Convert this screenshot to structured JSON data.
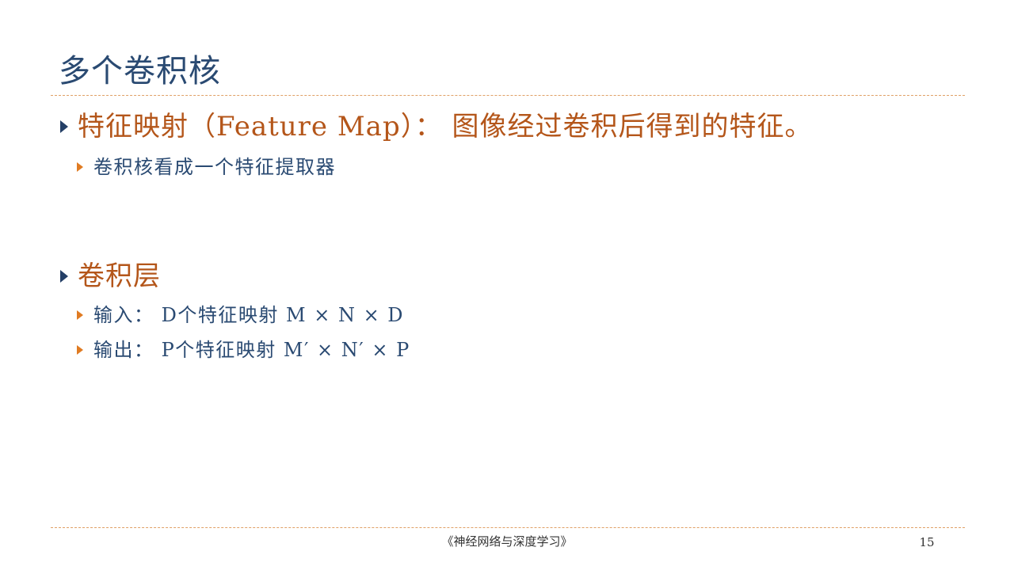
{
  "slide": {
    "title": "多个卷积核",
    "bullets": [
      {
        "text": "特征映射（Feature Map）： 图像经过卷积后得到的特征。",
        "sub": [
          "卷积核看成一个特征提取器"
        ]
      },
      {
        "text": "卷积层",
        "sub": [
          "输入： D个特征映射 M × N × D",
          "输出： P个特征映射 M′ × N′ × P"
        ]
      }
    ]
  },
  "footer": {
    "book_title": "《神经网络与深度学习》",
    "page_number": "15"
  },
  "colors": {
    "title": "#2a4a72",
    "level1_text": "#b4561a",
    "level1_bullet": "#243f66",
    "level2_text": "#2a4a72",
    "level2_bullet": "#e07b22",
    "rule": "#e0a066"
  }
}
